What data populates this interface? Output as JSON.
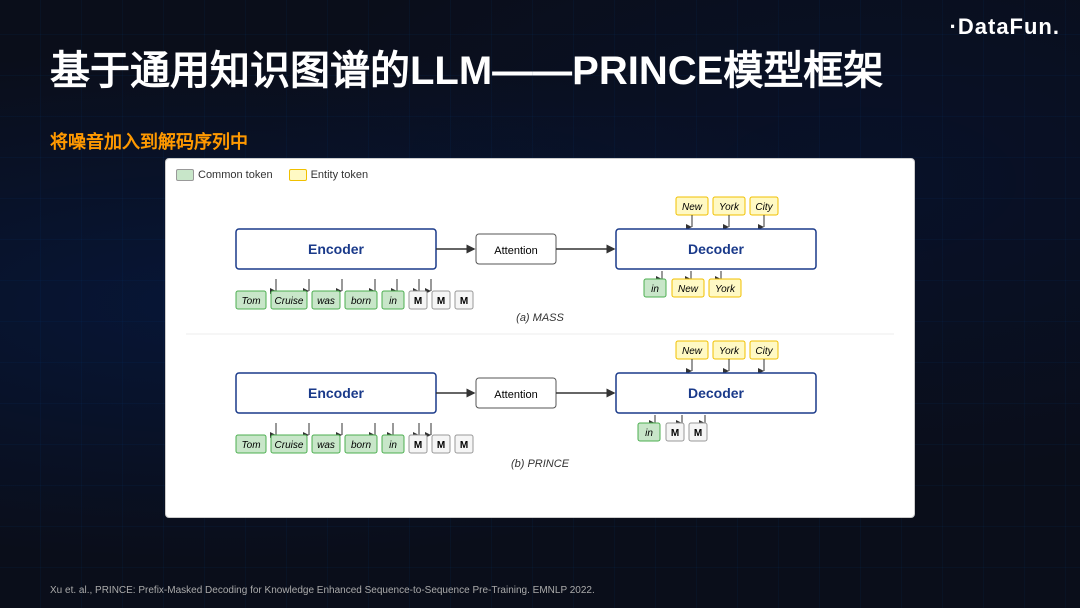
{
  "logo": {
    "prefix": "·DataFun",
    "dot": "·"
  },
  "title": "基于通用知识图谱的LLM——PRINCE模型框架",
  "subtitle": "将噪音加入到解码序列中",
  "legend": {
    "common_label": "Common token",
    "entity_label": "Entity token"
  },
  "diagram": {
    "part_a": {
      "caption": "(a) MASS",
      "encoder_label": "Encoder",
      "decoder_label": "Decoder",
      "attention_label": "Attention",
      "input_tokens": [
        "Tom",
        "Cruise",
        "was",
        "born",
        "in",
        "M",
        "M",
        "M"
      ],
      "input_types": [
        "green",
        "green",
        "green",
        "green",
        "green",
        "gray",
        "gray",
        "gray"
      ],
      "decoder_input_tokens": [
        "in",
        "New",
        "York"
      ],
      "decoder_input_types": [
        "green",
        "yellow",
        "yellow"
      ],
      "output_tokens": [
        "New",
        "York",
        "City"
      ],
      "output_types": [
        "yellow",
        "yellow",
        "yellow"
      ]
    },
    "part_b": {
      "caption": "(b) PRINCE",
      "encoder_label": "Encoder",
      "decoder_label": "Decoder",
      "attention_label": "Attention",
      "input_tokens": [
        "Tom",
        "Cruise",
        "was",
        "born",
        "in",
        "M",
        "M",
        "M"
      ],
      "input_types": [
        "green",
        "green",
        "green",
        "green",
        "green",
        "gray",
        "gray",
        "gray"
      ],
      "decoder_input_tokens": [
        "in",
        "M",
        "M"
      ],
      "decoder_input_types": [
        "green",
        "gray",
        "gray"
      ],
      "output_tokens": [
        "New",
        "York",
        "City"
      ],
      "output_types": [
        "yellow",
        "yellow",
        "yellow"
      ]
    }
  },
  "reference": "Xu et. al., PRINCE: Prefix-Masked Decoding for Knowledge Enhanced Sequence-to-Sequence Pre-Training. EMNLP 2022."
}
